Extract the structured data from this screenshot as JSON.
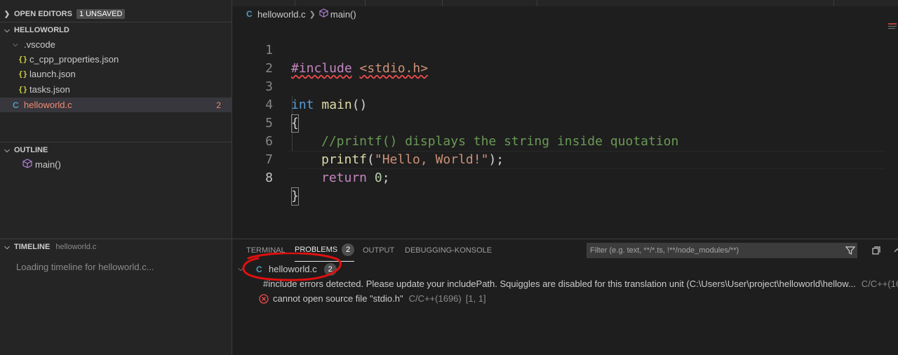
{
  "sidebar": {
    "open_editors": {
      "title": "OPEN EDITORS",
      "badge": "1 UNSAVED"
    },
    "explorer": {
      "title": "HELLOWORLD",
      "items": [
        {
          "label": ".vscode",
          "icon": "chevron-down-icon"
        },
        {
          "label": "c_cpp_properties.json",
          "icon": "json-icon"
        },
        {
          "label": "launch.json",
          "icon": "json-icon"
        },
        {
          "label": "tasks.json",
          "icon": "json-icon"
        },
        {
          "label": "helloworld.c",
          "icon": "c-file-icon",
          "problems": "2"
        }
      ]
    },
    "outline": {
      "title": "OUTLINE",
      "items": [
        {
          "label": "main()",
          "icon": "cube-icon"
        }
      ]
    },
    "timeline": {
      "title": "TIMELINE",
      "file": "helloworld.c",
      "message": "Loading timeline for helloworld.c..."
    }
  },
  "breadcrumb": {
    "file": "helloworld.c",
    "symbol": "main()"
  },
  "editor": {
    "line_numbers": [
      "1",
      "2",
      "3",
      "4",
      "5",
      "6",
      "7",
      "8"
    ],
    "line1": {
      "directive": "#include",
      "header": "<stdio.h>"
    },
    "line3": {
      "type": "int",
      "fn": "main",
      "parens": "()"
    },
    "line4": {
      "brace": "{"
    },
    "line5": {
      "comment": "//printf() displays the string inside quotation"
    },
    "line6": {
      "fn": "printf",
      "open": "(",
      "str": "\"Hello, World!\"",
      "close": ");"
    },
    "line7": {
      "kw": "return",
      "num": "0",
      "semi": ";"
    },
    "line8": {
      "brace": "}"
    }
  },
  "panel": {
    "tabs": [
      {
        "label": "TERMINAL"
      },
      {
        "label": "PROBLEMS",
        "count": "2"
      },
      {
        "label": "OUTPUT"
      },
      {
        "label": "DEBUGGING-KONSOLE"
      }
    ],
    "filter_placeholder": "Filter (e.g. text, **/*.ts, !**/node_modules/**)",
    "problems": {
      "file": "helloworld.c",
      "count": "2",
      "items": [
        {
          "message": "#include errors detected. Please update your includePath. Squiggles are disabled for this translation unit (C:\\Users\\User\\project\\helloworld\\hellow...",
          "source": "C/C++(16"
        },
        {
          "message": "cannot open source file \"stdio.h\"",
          "source": "C/C++(1696)",
          "location": "[1, 1]"
        }
      ]
    }
  },
  "colors": {
    "error": "#f14c4c",
    "annotation": "#e01010",
    "accent": "#519aba",
    "json": "#cbcb41"
  }
}
